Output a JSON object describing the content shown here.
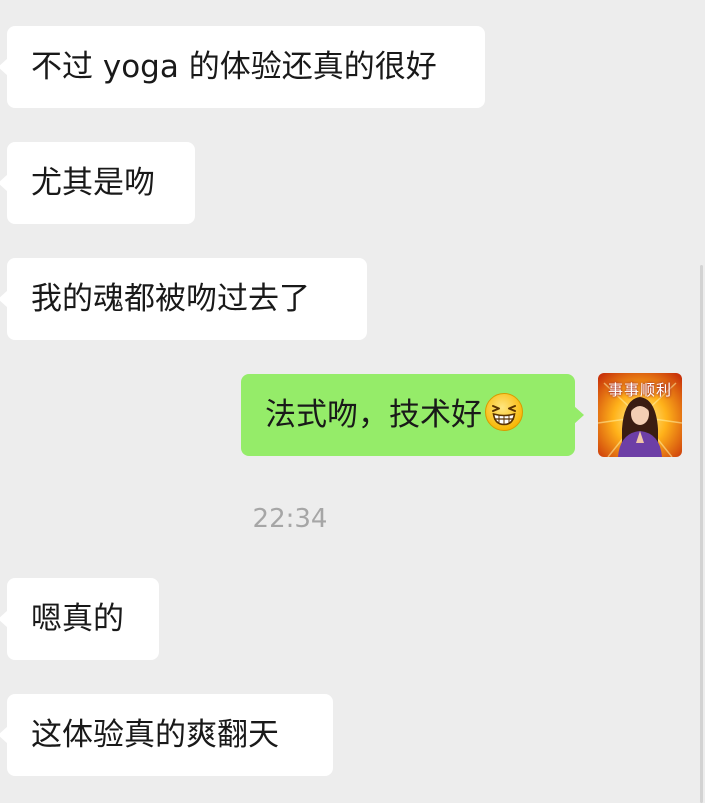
{
  "messages": [
    {
      "side": "in",
      "text": "不过 yoga 的体验还真的很好"
    },
    {
      "side": "in",
      "text": "尤其是吻"
    },
    {
      "side": "in",
      "text": "我的魂都被吻过去了"
    },
    {
      "side": "out",
      "text": "法式吻，技术好",
      "emoji": "grinning-squint-emoji"
    },
    {
      "side": "in",
      "text": "嗯真的"
    },
    {
      "side": "in",
      "text": "这体验真的爽翻天"
    }
  ],
  "timestamp": "22:34",
  "avatar": {
    "caption": "事事顺利"
  },
  "colors": {
    "background": "#ededed",
    "incoming_bubble": "#ffffff",
    "outgoing_bubble": "#95ec69",
    "timestamp_text": "#a6a6a6"
  }
}
